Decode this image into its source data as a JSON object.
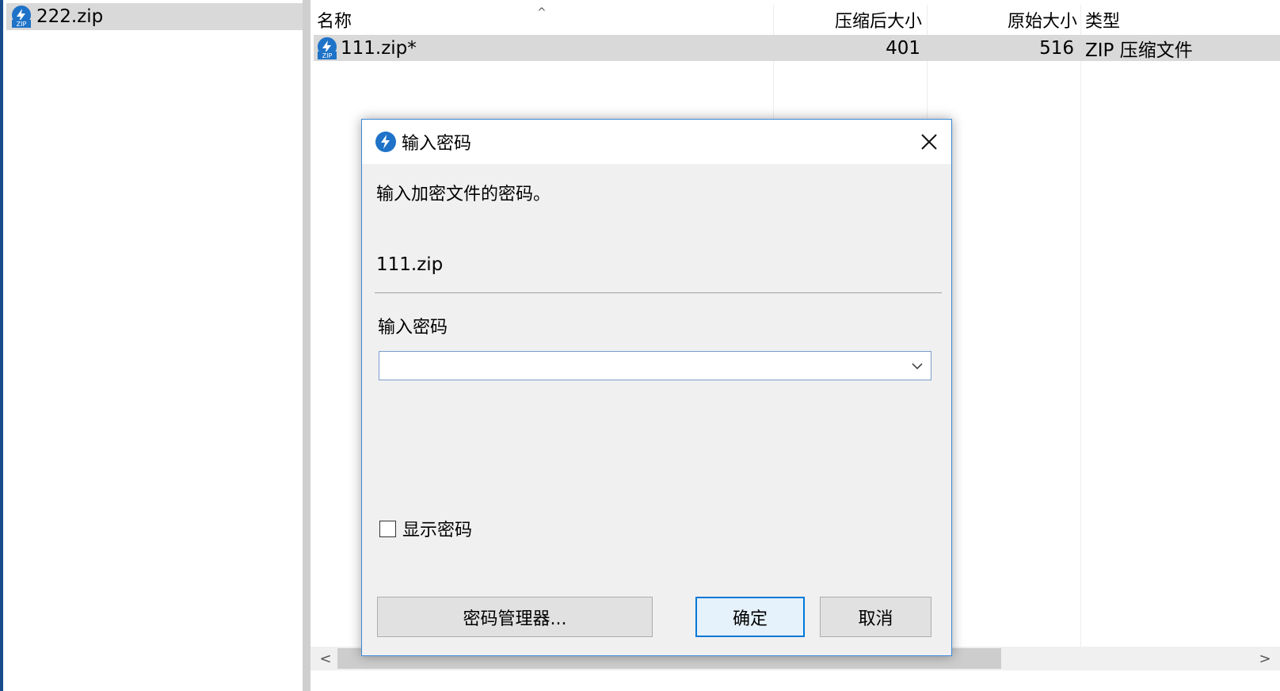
{
  "tree": {
    "items": [
      {
        "label": "222.zip"
      }
    ]
  },
  "list": {
    "columns": {
      "name": "名称",
      "compressed": "压缩后大小",
      "original": "原始大小",
      "type": "类型"
    },
    "sort_indicator": "^",
    "rows": [
      {
        "name": "111.zip*",
        "compressed": "401",
        "original": "516",
        "type": "ZIP 压缩文件"
      }
    ]
  },
  "scroll": {
    "left": "<",
    "right": ">"
  },
  "dialog": {
    "title": "输入密码",
    "prompt": "输入加密文件的密码。",
    "filename": "111.zip",
    "field_label": "输入密码",
    "password_value": "",
    "show_password_label": "显示密码",
    "show_password_checked": false,
    "buttons": {
      "manager": "密码管理器...",
      "ok": "确定",
      "cancel": "取消"
    }
  },
  "icons": {
    "file": "zip-file-icon",
    "app": "bandizip-app-icon",
    "close": "close-icon",
    "dropdown": "chevron-down-icon"
  },
  "colors": {
    "accent": "#0078d7",
    "selection": "#d9d9d9",
    "dialog_bg": "#f0f0f0"
  }
}
